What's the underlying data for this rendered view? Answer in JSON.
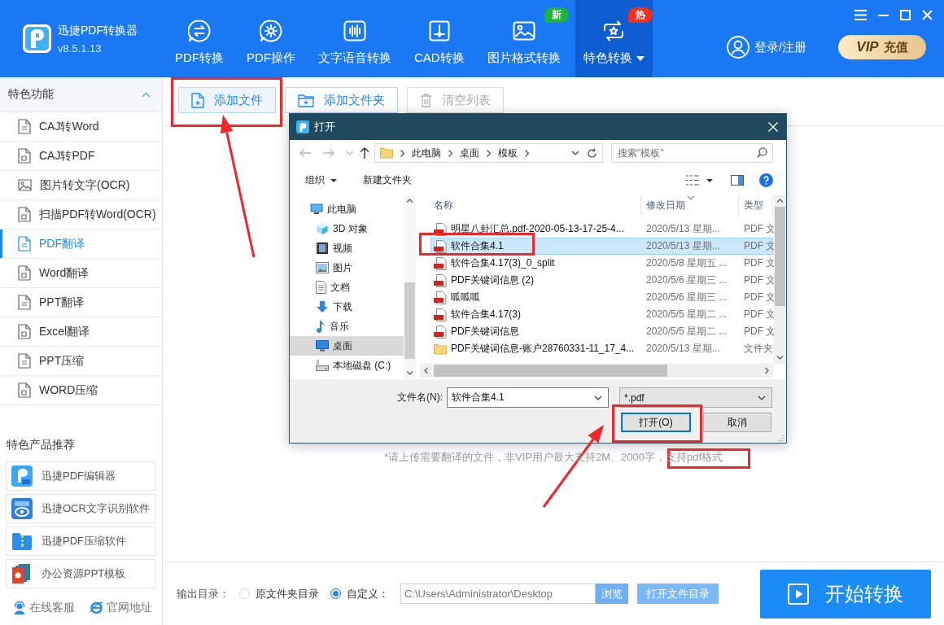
{
  "app": {
    "name": "迅捷PDF转换器",
    "version": "v8.5.1.13"
  },
  "nav": [
    {
      "label": "PDF转换",
      "selected": false,
      "dropdown": false
    },
    {
      "label": "PDF操作",
      "selected": false,
      "dropdown": false
    },
    {
      "label": "文字语音转换",
      "selected": false,
      "dropdown": false
    },
    {
      "label": "CAD转换",
      "selected": false,
      "dropdown": false
    },
    {
      "label": "图片格式转换",
      "selected": false,
      "dropdown": false,
      "badge": {
        "text": "新",
        "color": "#1db43a"
      }
    },
    {
      "label": "特色转换",
      "selected": true,
      "dropdown": true,
      "badge": {
        "text": "热",
        "color": "#f0301c"
      }
    }
  ],
  "account": {
    "label": "登录/注册"
  },
  "vip_button": {
    "mark": "VIP",
    "label": "充值"
  },
  "sidebar": {
    "section": {
      "title": "特色功能",
      "expanded": true
    },
    "items": [
      {
        "label": "CAJ转Word",
        "selected": false
      },
      {
        "label": "CAJ转PDF",
        "selected": false
      },
      {
        "label": "图片转文字(OCR)",
        "selected": false
      },
      {
        "label": "扫描PDF转Word(OCR)",
        "selected": false
      },
      {
        "label": "PDF翻译",
        "selected": true
      },
      {
        "label": "Word翻译",
        "selected": false
      },
      {
        "label": "PPT翻译",
        "selected": false
      },
      {
        "label": "Excel翻译",
        "selected": false
      },
      {
        "label": "PPT压缩",
        "selected": false
      },
      {
        "label": "WORD压缩",
        "selected": false
      }
    ],
    "recommend_title": "特色产品推荐",
    "products": [
      {
        "label": "迅捷PDF编辑器"
      },
      {
        "label": "迅捷OCR文字识别软件"
      },
      {
        "label": "迅捷PDF压缩软件"
      },
      {
        "label": "办公资源PPT模板"
      }
    ],
    "links": [
      {
        "label": "在线客服"
      },
      {
        "label": "官网地址"
      }
    ]
  },
  "toolbar": [
    {
      "label": "添加文件",
      "highlighted": true,
      "disabled": false
    },
    {
      "label": "添加文件夹",
      "highlighted": false,
      "disabled": false
    },
    {
      "label": "清空列表",
      "highlighted": false,
      "disabled": true
    }
  ],
  "upload_note": "*请上传需要翻译的文件，非VIP用户最大支持2M、2000字，支持pdf格式",
  "output": {
    "label": "输出目录：",
    "options": [
      {
        "label": "原文件夹目录",
        "selected": false
      },
      {
        "label": "自定义：",
        "selected": true
      }
    ],
    "path": "C:\\Users\\Administrator\\Desktop",
    "browse_button": "浏览",
    "open_folder_button": "打开文件目录"
  },
  "start_button": "开始转换",
  "dialog": {
    "title": "打开",
    "path": [
      "此电脑",
      "桌面",
      "模板"
    ],
    "search_placeholder": "搜索\"模板\"",
    "commands": [
      {
        "label": "组织",
        "dropdown": true
      },
      {
        "label": "新建文件夹",
        "dropdown": false
      }
    ],
    "tree": [
      {
        "label": "此电脑",
        "selected": false,
        "children": [
          {
            "label": "3D 对象",
            "selected": false
          },
          {
            "label": "视频",
            "selected": false
          },
          {
            "label": "图片",
            "selected": false
          },
          {
            "label": "文档",
            "selected": false
          },
          {
            "label": "下载",
            "selected": false
          },
          {
            "label": "音乐",
            "selected": false
          },
          {
            "label": "桌面",
            "selected": true
          },
          {
            "label": "本地磁盘 (C:)",
            "selected": false
          }
        ]
      }
    ],
    "columns": [
      "名称",
      "修改日期",
      "类型"
    ],
    "files": [
      {
        "kind": "pdf",
        "name": "明星八卦汇总.pdf-2020-05-13-17-25-4...",
        "date": "2020/5/13 星期...",
        "type": "PDF 文",
        "selected": false
      },
      {
        "kind": "pdf",
        "name": "软件合集4.1",
        "date": "2020/5/13 星期...",
        "type": "PDF 文",
        "selected": true
      },
      {
        "kind": "pdf",
        "name": "软件合集4.17(3)_0_split",
        "date": "2020/5/8 星期五 ...",
        "type": "PDF 文",
        "selected": false
      },
      {
        "kind": "pdf",
        "name": "PDF关键词信息 (2)",
        "date": "2020/5/6 星期三 ...",
        "type": "PDF 文",
        "selected": false
      },
      {
        "kind": "pdf",
        "name": "呱呱呱",
        "date": "2020/5/6 星期三 ...",
        "type": "PDF 文",
        "selected": false
      },
      {
        "kind": "pdf",
        "name": "软件合集4.17(3)",
        "date": "2020/5/5 星期二 ...",
        "type": "PDF 文",
        "selected": false
      },
      {
        "kind": "pdf",
        "name": "PDF关键词信息",
        "date": "2020/5/5 星期二 ...",
        "type": "PDF 文",
        "selected": false
      },
      {
        "kind": "folder",
        "name": "PDF关键词信息-账户28760331-11_17_4...",
        "date": "2020/5/13 星期...",
        "type": "文件夹",
        "selected": false
      }
    ],
    "filename_label": "文件名(N):",
    "filename": "软件合集4.1",
    "filetype": "*.pdf",
    "buttons": [
      {
        "label": "打开(O)",
        "focused": true
      },
      {
        "label": "取消",
        "focused": false
      }
    ]
  }
}
